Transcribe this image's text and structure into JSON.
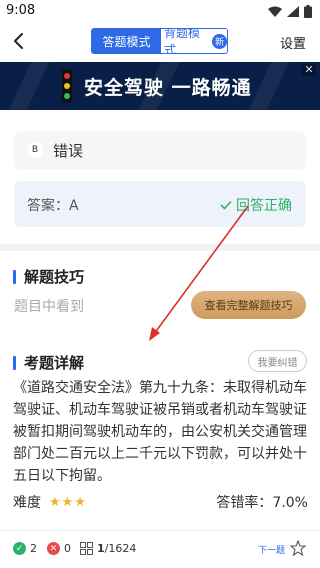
{
  "status": {
    "time": "9:08"
  },
  "header": {
    "mode_answer": "答题模式",
    "mode_memorize": "背题模式",
    "new_badge": "新",
    "settings": "设置"
  },
  "banner": {
    "text": "安全驾驶 一路畅通",
    "close": "✕"
  },
  "option_b": {
    "letter": "B",
    "label": "错误"
  },
  "answer": {
    "label": "答案：A",
    "result": "回答正确"
  },
  "tips": {
    "title": "解题技巧",
    "preview": "题目中看到",
    "button": "查看完整解题技巧"
  },
  "detail": {
    "title": "考题详解",
    "report": "我要纠错",
    "body": "《道路交通安全法》第九十九条：未取得机动车驾驶证、机动车驾驶证被吊销或者机动车驾驶证被暂扣期间驾驶机动车的，由公安机关交通管理部门处二百元以上二千元以下罚款，可以并处十五日以下拘留。"
  },
  "meta": {
    "difficulty_label": "难度",
    "stars": "★★★",
    "error_rate": "答错率：7.0%"
  },
  "bottom": {
    "correct_count": "2",
    "wrong_count": "0",
    "progress_current": "1",
    "progress_total": "/1624",
    "next": "下一题"
  },
  "colors": {
    "accent": "#2f6ae6",
    "success": "#2bb36b",
    "error": "#e84a4a",
    "banner_bg": "#0a1f47",
    "arrow": "#d9302a"
  }
}
